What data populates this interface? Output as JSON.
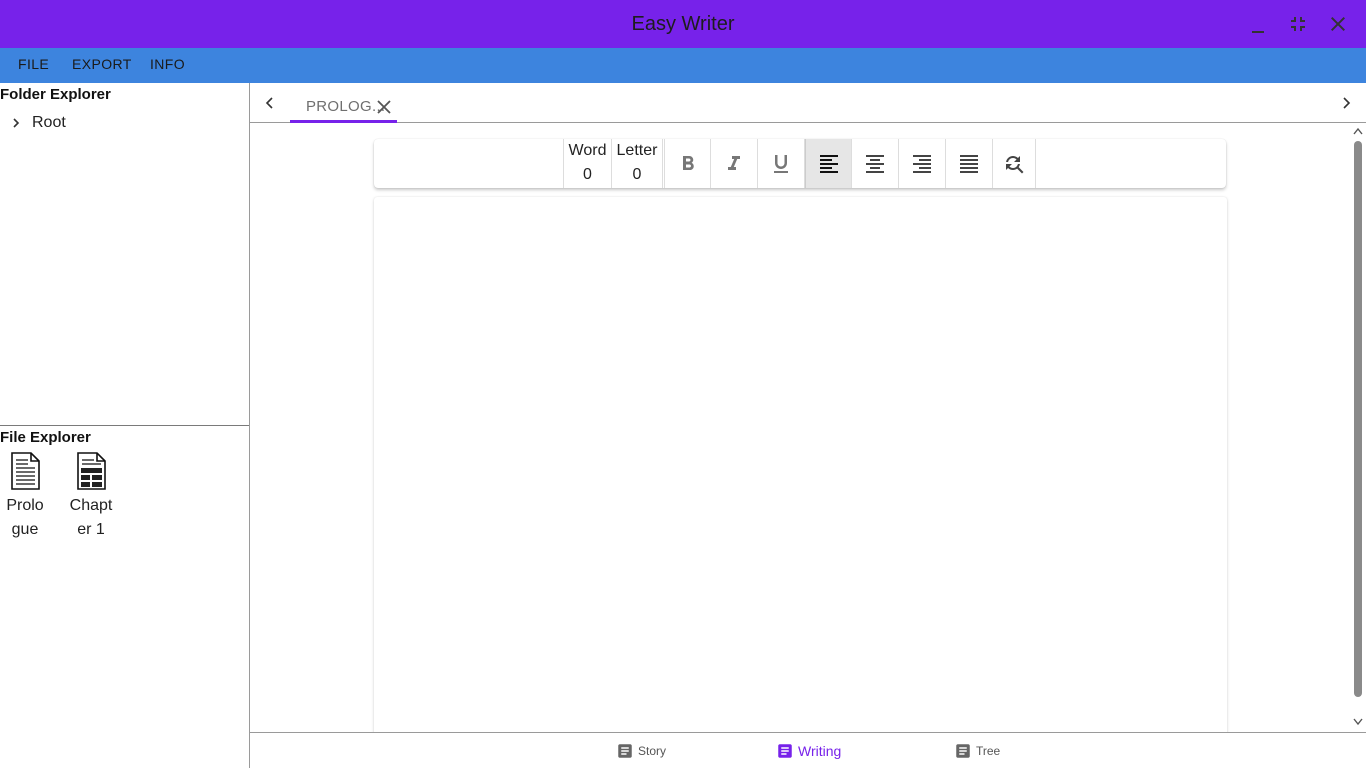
{
  "app": {
    "title": "Easy Writer"
  },
  "menu": {
    "file": "FILE",
    "export": "EXPORT",
    "info": "INFO"
  },
  "folder_explorer": {
    "title": "Folder Explorer",
    "items": [
      {
        "label": "Root"
      }
    ]
  },
  "file_explorer": {
    "title": "File Explorer",
    "files": [
      {
        "label": "Prologue",
        "icon": "text-document-icon"
      },
      {
        "label": "Chapter 1",
        "icon": "chapter-document-icon"
      }
    ]
  },
  "tabs": [
    {
      "label": "PROLOG...",
      "active": true
    }
  ],
  "toolbar": {
    "word_label": "Word",
    "word_count": "0",
    "letter_label": "Letter",
    "letter_count": "0",
    "active_alignment": "left"
  },
  "bottom_nav": {
    "items": [
      {
        "label": "Story",
        "active": false
      },
      {
        "label": "Writing",
        "active": true
      },
      {
        "label": "Tree",
        "active": false
      }
    ]
  },
  "colors": {
    "title_bar": "#7722ea",
    "menu_bar": "#3d84de",
    "accent": "#7722ea"
  }
}
